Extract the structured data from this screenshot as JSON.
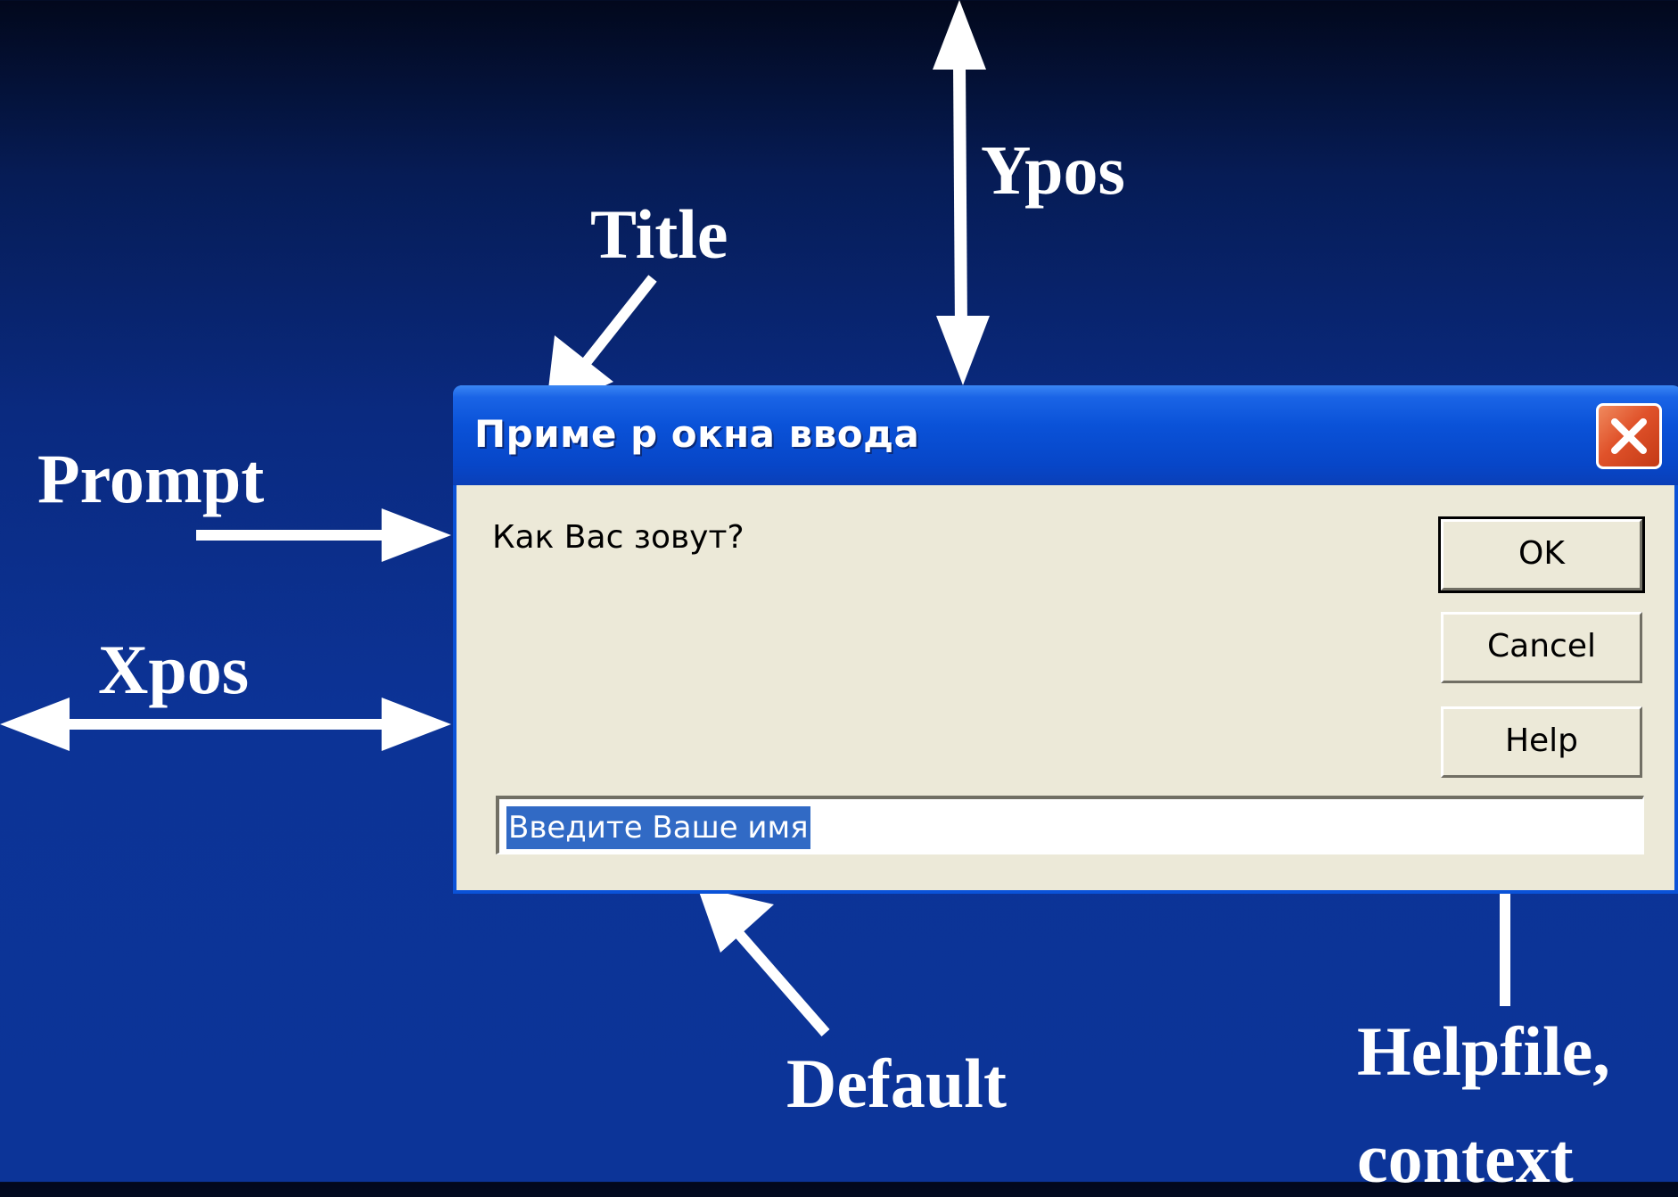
{
  "annotations": {
    "ypos": "Ypos",
    "title": "Title",
    "prompt": "Prompt",
    "xpos": "Xpos",
    "default": "Default",
    "helpfile": "Helpfile,",
    "context": "context"
  },
  "dialog": {
    "title": "Приме р окна ввода",
    "prompt": "Как Вас зовут?",
    "buttons": {
      "ok": "OK",
      "cancel": "Cancel",
      "help": "Help"
    },
    "input_value": "Введите Ваше имя",
    "close_icon": "close-icon"
  },
  "colors": {
    "background": "#0c3498",
    "titlebar": "#0a52d8",
    "dialog_face": "#ece9d8",
    "close_button": "#e0522a",
    "selection": "#316ac5",
    "annotation_text": "#ffffff"
  }
}
